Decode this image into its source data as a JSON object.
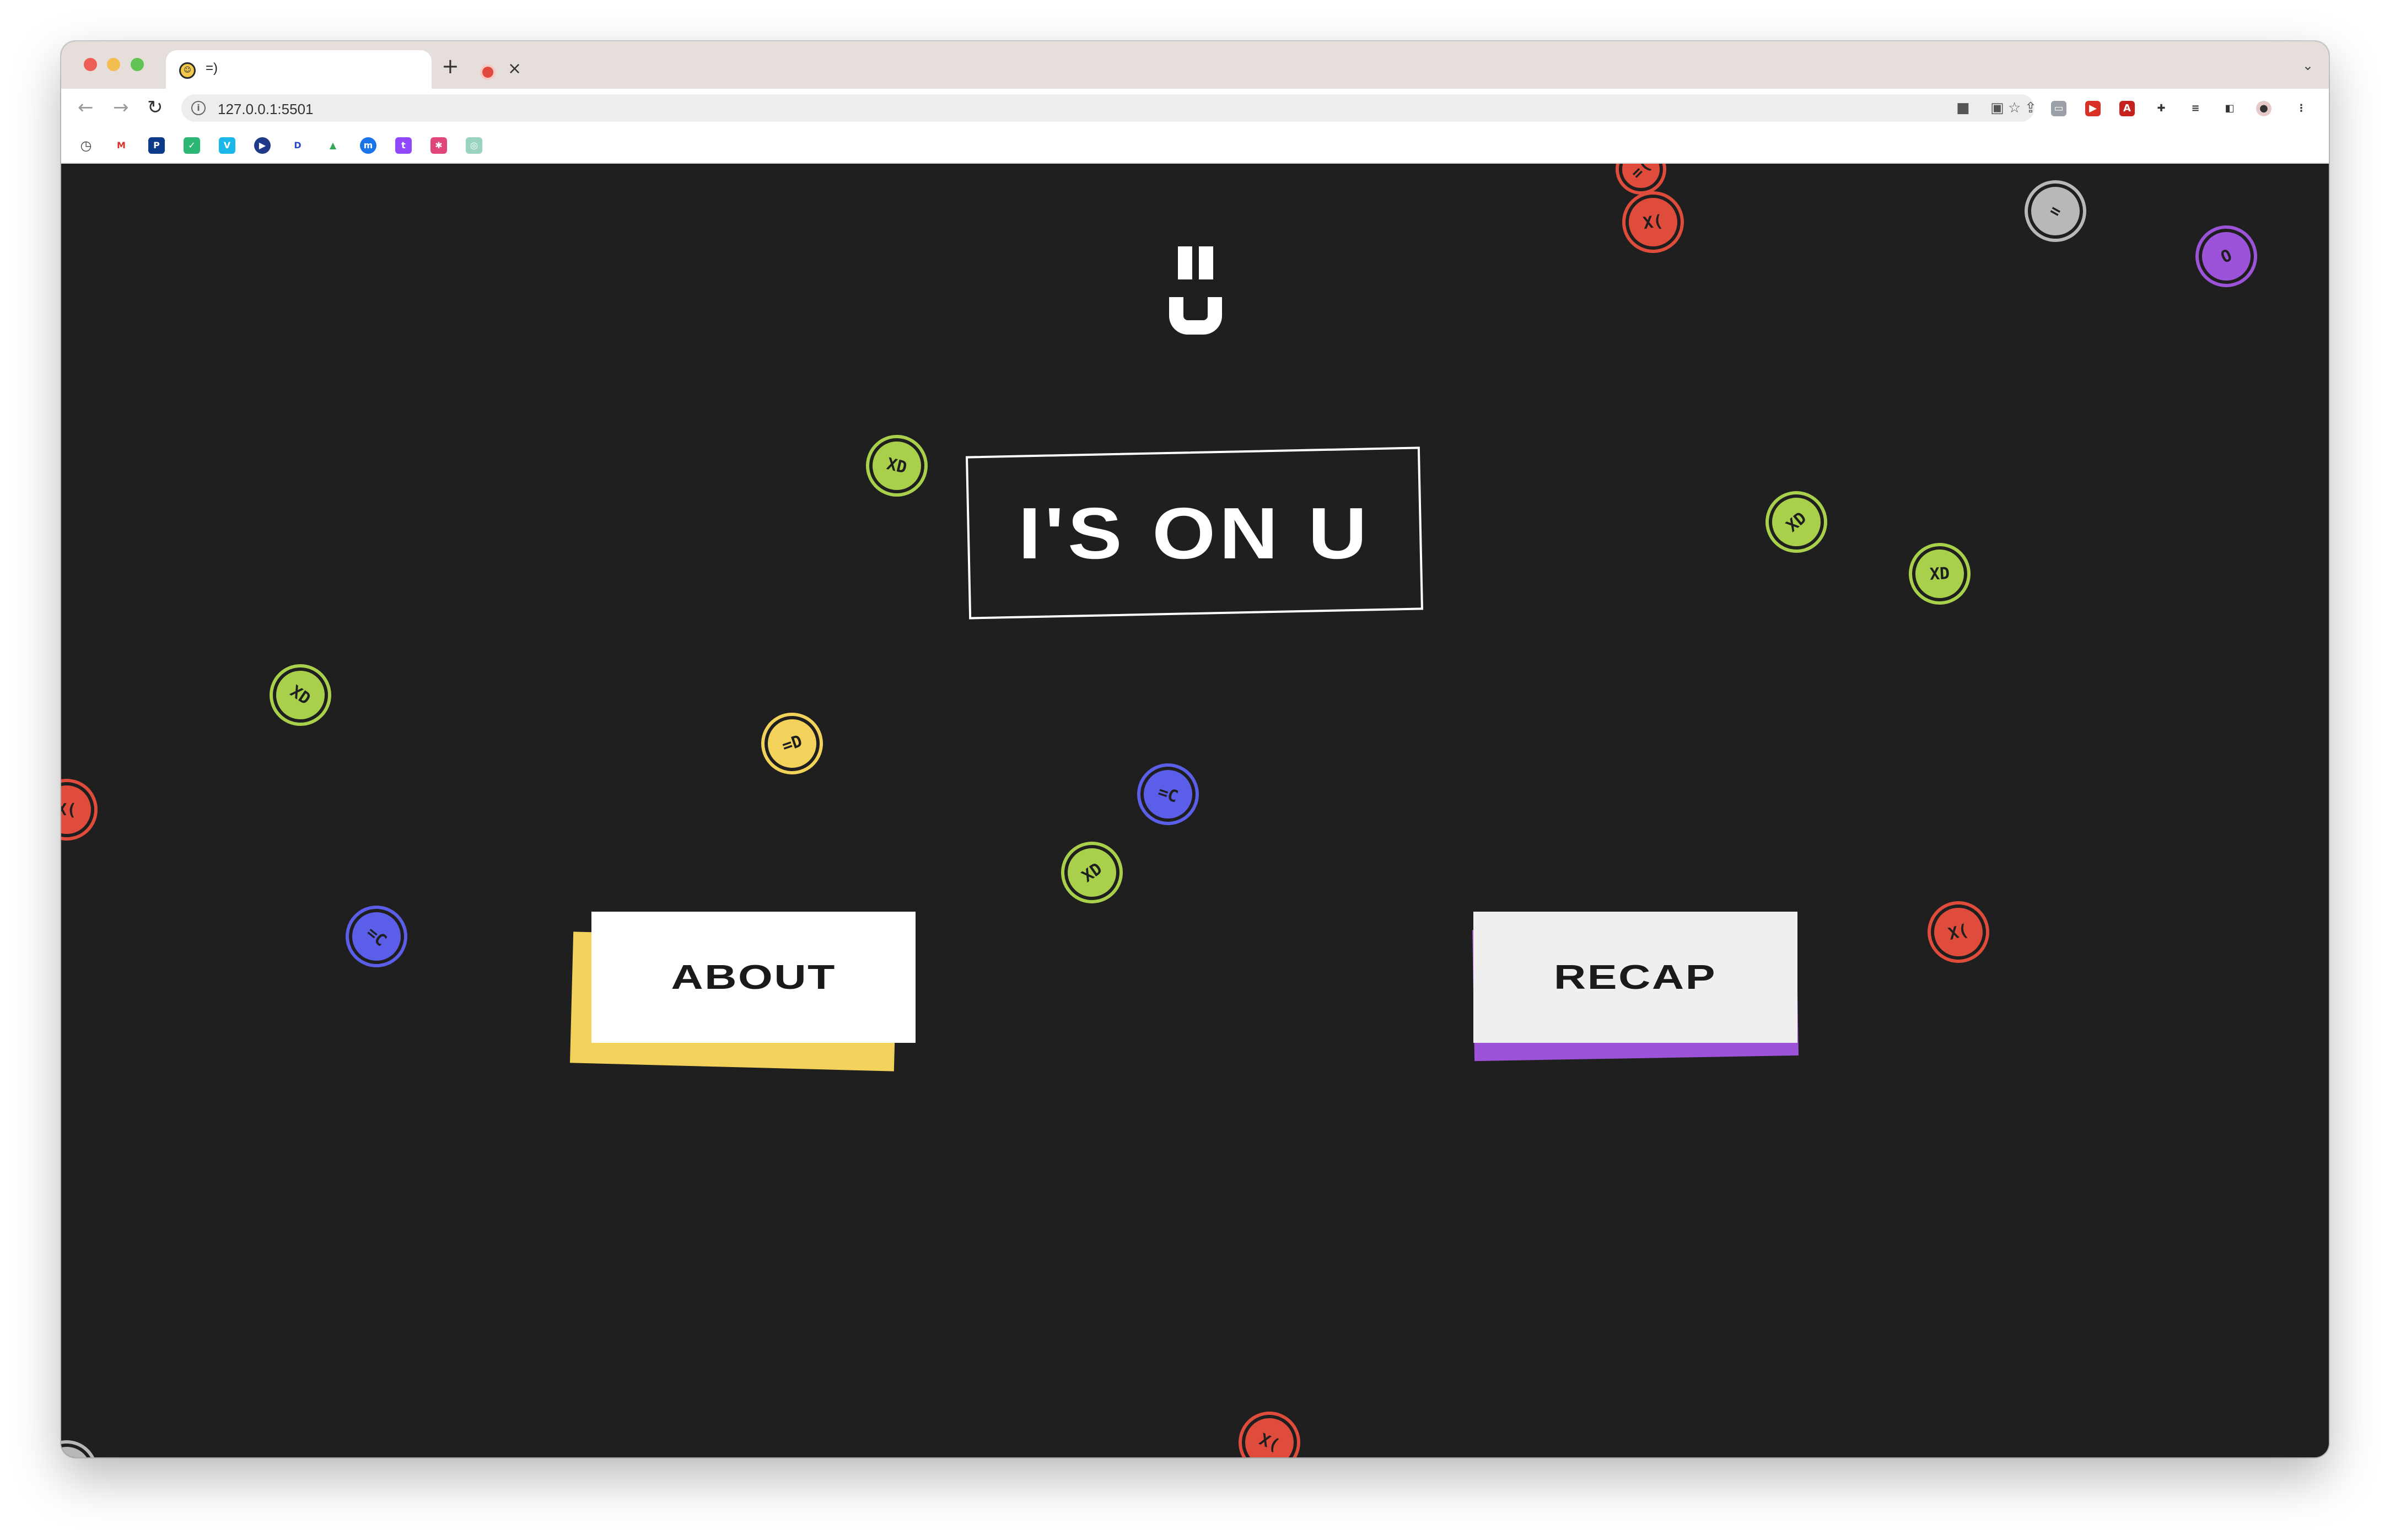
{
  "browser": {
    "tab": {
      "favicon": "smiley-favicon",
      "title": "=)"
    },
    "address": {
      "url": "127.0.0.1:5501"
    }
  },
  "page": {
    "logo_icon": "equals-u-logo",
    "title": "I'S ON U",
    "buttons": {
      "about": "ABOUT",
      "recap": "RECAP"
    },
    "colors": {
      "background": "#1f1f1f",
      "about_accent": "#f2d25a",
      "recap_accent": "#9d53d9",
      "smiley_green": "#a8d04a",
      "smiley_red": "#e04c3b",
      "smiley_yellow": "#f2d25a",
      "smiley_blue": "#5a5ee8",
      "smiley_purple": "#9d53d9",
      "smiley_gray": "#b8b8b8"
    },
    "smileys": [
      {
        "color": "#e04c3b",
        "face": "=("
      },
      {
        "color": "#e04c3b",
        "face": "X("
      },
      {
        "color": "#b8b8b8",
        "face": "="
      },
      {
        "color": "#9d53d9",
        "face": "O"
      },
      {
        "color": "#a8d04a",
        "face": "XD"
      },
      {
        "color": "#a8d04a",
        "face": "XD"
      },
      {
        "color": "#a8d04a",
        "face": "XD"
      },
      {
        "color": "#a8d04a",
        "face": "XD"
      },
      {
        "color": "#f2d25a",
        "face": "=D"
      },
      {
        "color": "#5a5ee8",
        "face": "=C"
      },
      {
        "color": "#a8d04a",
        "face": "XD"
      },
      {
        "color": "#e04c3b",
        "face": "X("
      },
      {
        "color": "#5a5ee8",
        "face": "=C"
      },
      {
        "color": "#e04c3b",
        "face": "X("
      },
      {
        "color": "#e04c3b",
        "face": "X("
      },
      {
        "color": "#b8b8b8",
        "face": "="
      }
    ]
  }
}
